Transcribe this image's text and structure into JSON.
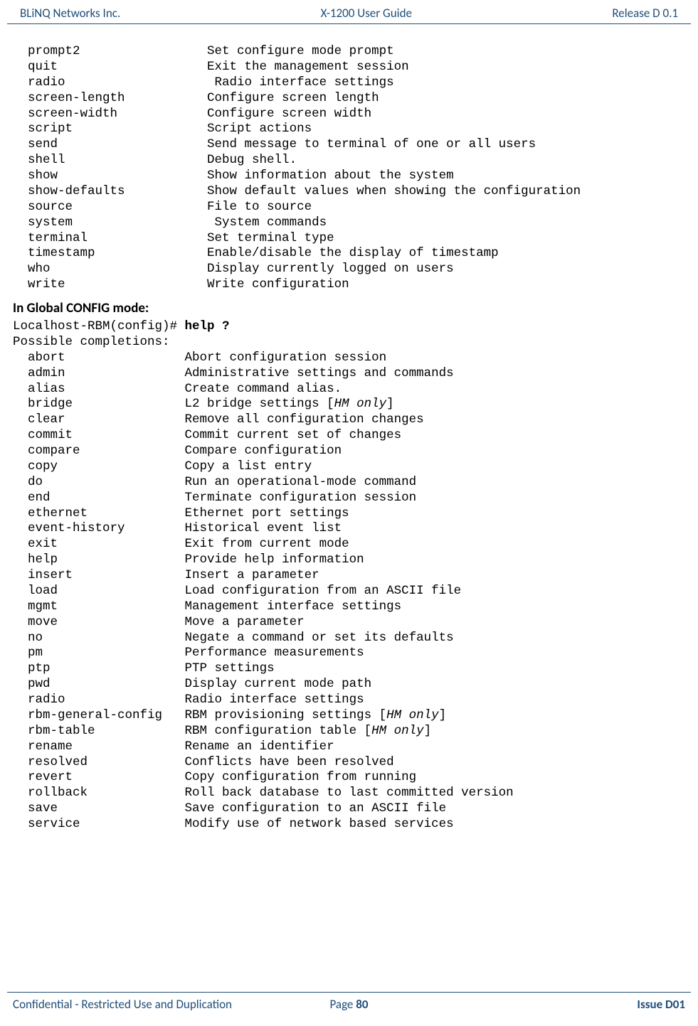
{
  "header": {
    "left": "BLiNQ Networks Inc.",
    "center": "X-1200 User Guide",
    "right": "Release D 0.1"
  },
  "block1": [
    {
      "cmd": "prompt2",
      "pad": 17,
      "desc": "Set configure mode prompt"
    },
    {
      "cmd": "quit",
      "pad": 20,
      "desc": "Exit the management session"
    },
    {
      "cmd": "radio",
      "pad": 20,
      "desc": "Radio interface settings"
    },
    {
      "cmd": "screen-length",
      "pad": 11,
      "desc": "Configure screen length"
    },
    {
      "cmd": "screen-width",
      "pad": 12,
      "desc": "Configure screen width"
    },
    {
      "cmd": "script",
      "pad": 18,
      "desc": "Script actions"
    },
    {
      "cmd": "send",
      "pad": 20,
      "desc": "Send message to terminal of one or all users"
    },
    {
      "cmd": "shell",
      "pad": 19,
      "desc": "Debug shell."
    },
    {
      "cmd": "show",
      "pad": 20,
      "desc": "Show information about the system"
    },
    {
      "cmd": "show-defaults",
      "pad": 11,
      "desc": "Show default values when showing the configuration"
    },
    {
      "cmd": "source",
      "pad": 18,
      "desc": "File to source"
    },
    {
      "cmd": "system",
      "pad": 19,
      "desc": "System commands"
    },
    {
      "cmd": "terminal",
      "pad": 16,
      "desc": "Set terminal type"
    },
    {
      "cmd": "timestamp",
      "pad": 15,
      "desc": "Enable/disable the display of timestamp"
    },
    {
      "cmd": "who",
      "pad": 21,
      "desc": "Display currently logged on users"
    },
    {
      "cmd": "write",
      "pad": 19,
      "desc": "Write configuration"
    }
  ],
  "heading": "In Global CONFIG mode:",
  "promptline": {
    "prefix": "Localhost-RBM(config)# ",
    "cmd": "help ?"
  },
  "completions_label": "Possible completions:",
  "block2": [
    {
      "cmd": "abort",
      "desc": "Abort configuration session"
    },
    {
      "cmd": "admin",
      "desc": "Administrative settings and commands"
    },
    {
      "cmd": "alias",
      "desc": "Create command alias."
    },
    {
      "cmd": "bridge",
      "desc_pre": "L2 bridge settings [",
      "desc_it": "HM only",
      "desc_post": "]"
    },
    {
      "cmd": "clear",
      "desc": "Remove all configuration changes"
    },
    {
      "cmd": "commit",
      "desc": "Commit current set of changes"
    },
    {
      "cmd": "compare",
      "desc": "Compare configuration"
    },
    {
      "cmd": "copy",
      "desc": "Copy a list entry"
    },
    {
      "cmd": "do",
      "desc": "Run an operational-mode command"
    },
    {
      "cmd": "end",
      "desc": "Terminate configuration session"
    },
    {
      "cmd": "ethernet",
      "desc": "Ethernet port settings"
    },
    {
      "cmd": "event-history",
      "desc": "Historical event list"
    },
    {
      "cmd": "exit",
      "desc": "Exit from current mode"
    },
    {
      "cmd": "help",
      "desc": "Provide help information"
    },
    {
      "cmd": "insert",
      "desc": "Insert a parameter"
    },
    {
      "cmd": "load",
      "desc": "Load configuration from an ASCII file"
    },
    {
      "cmd": "mgmt",
      "desc": "Management interface settings"
    },
    {
      "cmd": "move",
      "desc": "Move a parameter"
    },
    {
      "cmd": "no",
      "desc": "Negate a command or set its defaults"
    },
    {
      "cmd": "pm",
      "desc": "Performance measurements"
    },
    {
      "cmd": "ptp",
      "desc": "PTP settings"
    },
    {
      "cmd": "pwd",
      "desc": "Display current mode path"
    },
    {
      "cmd": "radio",
      "desc": "Radio interface settings"
    },
    {
      "cmd": "rbm-general-config",
      "desc_pre": "RBM provisioning settings [",
      "desc_it": "HM only",
      "desc_post": "]"
    },
    {
      "cmd": "rbm-table",
      "desc_pre": "RBM configuration table [",
      "desc_it": "HM only",
      "desc_post": "]"
    },
    {
      "cmd": "rename",
      "desc": "Rename an identifier"
    },
    {
      "cmd": "resolved",
      "desc": "Conflicts have been resolved"
    },
    {
      "cmd": "revert",
      "desc": "Copy configuration from running"
    },
    {
      "cmd": "rollback",
      "desc": "Roll back database to last committed version"
    },
    {
      "cmd": "save",
      "desc": "Save configuration to an ASCII file"
    },
    {
      "cmd": "service",
      "desc": "Modify use of network based services"
    }
  ],
  "footer": {
    "left": "Confidential - Restricted Use and Duplication",
    "center_prefix": "Page ",
    "center_page": "80",
    "right": "Issue D01"
  }
}
